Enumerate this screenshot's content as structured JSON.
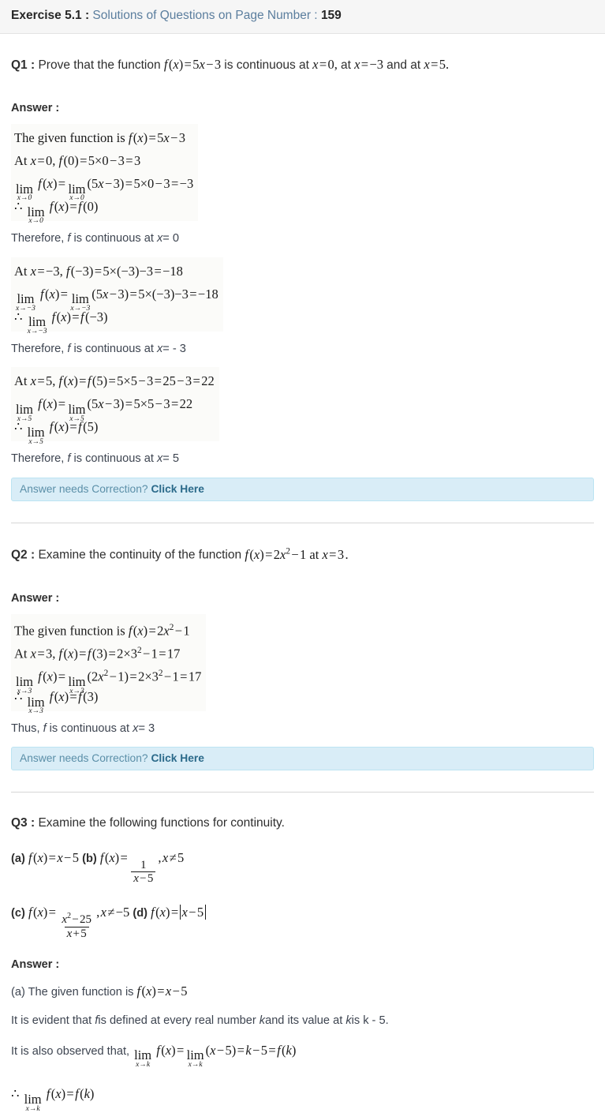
{
  "header": {
    "exercise_label": "Exercise 5.1 :",
    "subtitle": "Solutions of Questions on Page Number :",
    "page_number": "159"
  },
  "colors": {
    "header_bg": "#f6f6f6",
    "link_blue": "#5b7e9e",
    "correction_bg": "#d9edf7",
    "correction_border": "#bce4f2",
    "correction_text": "#5b8fa8",
    "correction_link": "#2b6a8a",
    "divider": "#d6d6d6",
    "body_text": "#3d4450"
  },
  "correction": {
    "prompt": "Answer needs Correction?",
    "link_label": "Click Here"
  },
  "questions": [
    {
      "label": "Q1 :",
      "text_before": "Prove that the function",
      "math_statement": "f(x) = 5x - 3 is continuous at x = 0, at x = -3 and at x = 5.",
      "answer_label": "Answer :",
      "steps": [
        {
          "math_lines": [
            "The given function is f(x) = 5x - 3",
            "At x = 0, f(0) = 5 x 0 - 3 = 3",
            "lim x->0 f(x) = lim x->0 (5x - 3) = 5 x 0 - 3 = -3",
            "therefore lim x->0 f(x) = f(0)"
          ],
          "conclusion": "Therefore, f is continuous at x= 0"
        },
        {
          "math_lines": [
            "At x = -3, f(-3) = 5 x (-3) - 3 = -18",
            "lim x->-3 f(x) = lim x->-3 (5x - 3) = 5 x (-3) - 3 = -18",
            "therefore lim x->-3 f(x) = f(-3)"
          ],
          "conclusion": "Therefore, f is continuous at x= - 3"
        },
        {
          "math_lines": [
            "At x = 5, f(x) = f(5) = 5 x 5 - 3 = 25 - 3 = 22",
            "lim x->5 f(x) = lim x->5 (5x - 3) = 5 x 5 - 3 = 22",
            "therefore lim x->5 f(x) = f(5)"
          ],
          "conclusion": "Therefore, f is continuous at x= 5"
        }
      ]
    },
    {
      "label": "Q2 :",
      "text_before": "Examine the continuity of the function",
      "math_statement": "f(x) = 2x^2 - 1 at x = 3.",
      "answer_label": "Answer :",
      "math_lines": [
        "The given function is f(x) = 2x^2 - 1",
        "At x = 3, f(x) = f(3) = 2 x 3^2 - 1 = 17",
        "lim x->3 f(x) = lim x->3 (2x^2 - 1) = 2 x 3^2 - 1 = 17",
        "therefore lim x->3 f(x) = f(3)"
      ],
      "conclusion": "Thus, f is continuous at x= 3"
    },
    {
      "label": "Q3 :",
      "text_before": "Examine the following functions for continuity.",
      "parts": [
        {
          "tag": "(a)",
          "math": "f(x) = x - 5"
        },
        {
          "tag": "(b)",
          "math": "f(x) = 1/(x-5), x != 5"
        },
        {
          "tag": "(c)",
          "math": "f(x) = (x^2 - 25)/(x + 5), x != -5"
        },
        {
          "tag": "(d)",
          "math": "f(x) = |x - 5|"
        }
      ],
      "answer_label": "Answer :",
      "answer_lines": [
        "(a) The given function is f(x) = x - 5",
        "It is evident that f is defined at every real number k and its value at k is k - 5.",
        "It is also observed that, lim x->k f(x) = lim x->k (x - 5) = k - 5 = f(k)",
        "therefore lim x->k f(x) = f(k)"
      ],
      "answer_prose": {
        "part_a_intro": "(a) The given function is",
        "evident_pre": "It is evident that",
        "evident_f": "f",
        "evident_mid1": "is defined at every real number",
        "evident_k1": "k",
        "evident_mid2": "and its value at",
        "evident_k2": "k",
        "evident_tail": "is k - 5.",
        "observed": "It is also observed that,"
      }
    }
  ]
}
